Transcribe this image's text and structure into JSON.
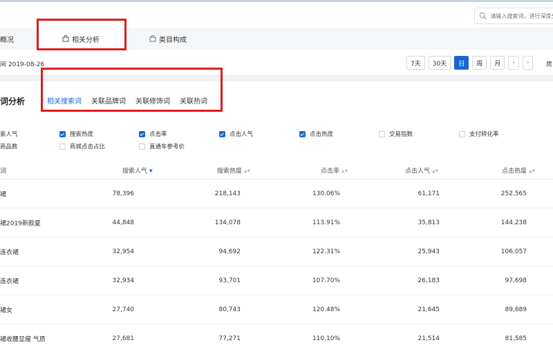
{
  "search": {
    "placeholder": "请输入搜索词，进行深度分析"
  },
  "tabs": [
    {
      "label": "概况"
    },
    {
      "label": "相关分析"
    },
    {
      "label": "类目构成"
    }
  ],
  "date": {
    "label": "间 2019-08-26",
    "extra": "房"
  },
  "periods": [
    "7天",
    "30天",
    "日",
    "周",
    "月",
    "‹",
    "›"
  ],
  "section": {
    "title": "词分析"
  },
  "sub_tabs": [
    "相关搜索词",
    "关联品牌词",
    "关联修饰词",
    "关联热词"
  ],
  "metrics": [
    {
      "label": "索人气",
      "checked": true
    },
    {
      "label": "搜索热度",
      "checked": true
    },
    {
      "label": "点击率",
      "checked": true
    },
    {
      "label": "点击人气",
      "checked": true
    },
    {
      "label": "点击热度",
      "checked": true
    },
    {
      "label": "交易指数",
      "checked": false
    },
    {
      "label": "支付转化率",
      "checked": false
    },
    {
      "label": "商品数",
      "checked": false
    },
    {
      "label": "商城点击占比",
      "checked": false
    },
    {
      "label": "直通车参考价",
      "checked": false
    }
  ],
  "table": {
    "headers": [
      "词",
      "搜索人气",
      "搜索热度",
      "点击率",
      "点击人气",
      "点击热度"
    ],
    "rows": [
      [
        "裙",
        "78,396",
        "218,143",
        "130.06%",
        "61,171",
        "252,565"
      ],
      [
        "裙2019新款夏",
        "44,848",
        "134,078",
        "113.91%",
        "35,813",
        "144,238"
      ],
      [
        "连衣裙",
        "32,954",
        "94,692",
        "122.31%",
        "25,943",
        "106,057"
      ],
      [
        "连衣裙",
        "32,934",
        "93,701",
        "107.70%",
        "26,183",
        "97,698"
      ],
      [
        "裙女",
        "27,740",
        "80,743",
        "120.48%",
        "21,645",
        "89,689"
      ],
      [
        "裙收腰显瘦 气质",
        "27,681",
        "77,271",
        "110.10%",
        "21,514",
        "81,585"
      ]
    ]
  },
  "colors": {
    "accent": "#1966d2",
    "highlight": "#e01b1b"
  }
}
